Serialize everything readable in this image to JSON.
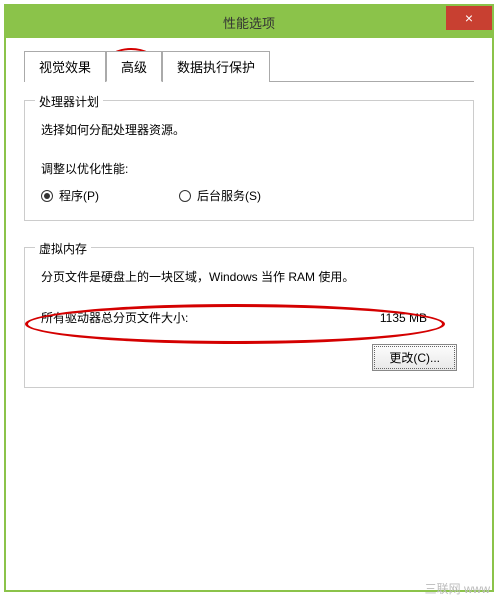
{
  "window": {
    "title": "性能选项",
    "close_label": "×"
  },
  "tabs": {
    "items": [
      {
        "label": "视觉效果"
      },
      {
        "label": "高级"
      },
      {
        "label": "数据执行保护"
      }
    ]
  },
  "processor": {
    "legend": "处理器计划",
    "desc": "选择如何分配处理器资源。",
    "optimize_label": "调整以优化性能:",
    "radio_programs": "程序(P)",
    "radio_services": "后台服务(S)"
  },
  "vm": {
    "legend": "虚拟内存",
    "desc": "分页文件是硬盘上的一块区域，Windows 当作 RAM 使用。",
    "total_label": "所有驱动器总分页文件大小:",
    "total_value": "1135 MB",
    "change_btn": "更改(C)..."
  },
  "watermark": "三联网 www"
}
